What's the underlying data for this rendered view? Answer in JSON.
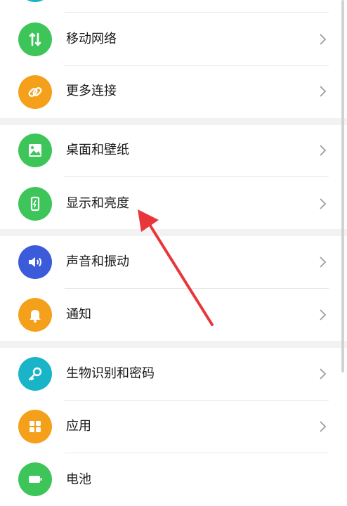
{
  "settings": {
    "items": [
      {
        "label": "移动网络",
        "icon": "mobile-network-icon",
        "color": "#3dc55a"
      },
      {
        "label": "更多连接",
        "icon": "link-icon",
        "color": "#f5a01a"
      },
      {
        "label": "桌面和壁纸",
        "icon": "wallpaper-icon",
        "color": "#3dc55a"
      },
      {
        "label": "显示和亮度",
        "icon": "display-brightness-icon",
        "color": "#3dc55a"
      },
      {
        "label": "声音和振动",
        "icon": "sound-icon",
        "color": "#3b5bdb"
      },
      {
        "label": "通知",
        "icon": "bell-icon",
        "color": "#f5a01a"
      },
      {
        "label": "生物识别和密码",
        "icon": "key-icon",
        "color": "#19b4c8"
      },
      {
        "label": "应用",
        "icon": "apps-grid-icon",
        "color": "#f5a01a"
      },
      {
        "label": "电池",
        "icon": "battery-icon",
        "color": "#3dc55a"
      }
    ]
  },
  "annotation": {
    "arrow_color": "#e8373b",
    "icon": "red-arrow-annotation"
  }
}
